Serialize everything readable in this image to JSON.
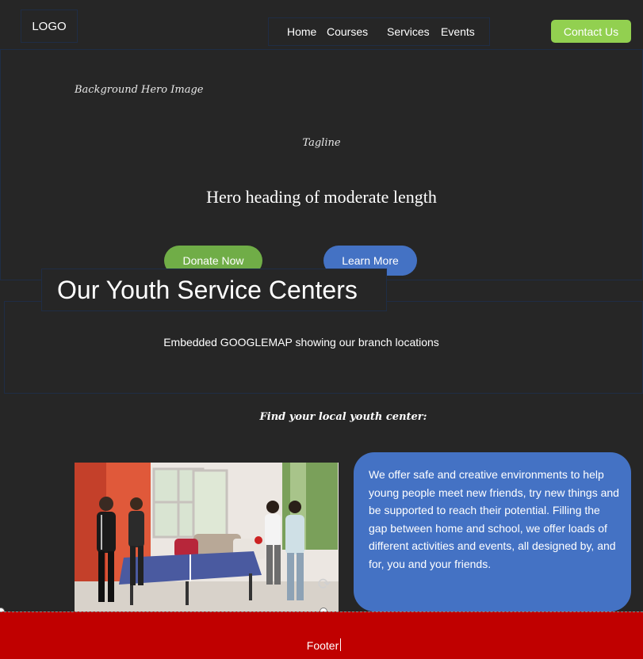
{
  "header": {
    "logo": "LOGO",
    "nav": [
      "Home",
      "Courses",
      "Services",
      "Events"
    ],
    "contact_button": "Contact Us"
  },
  "hero": {
    "background_label": "Background Hero Image",
    "tagline": "Tagline",
    "heading": "Hero heading of moderate length",
    "donate_button": "Donate Now",
    "learn_button": "Learn More"
  },
  "section": {
    "title": "Our Youth Service Centers",
    "map_label": "Embedded GOOGLEMAP showing our branch locations",
    "find_label": "Find your local youth center:"
  },
  "info": {
    "text": "We offer safe and creative environments to help young people meet new friends, try new things and be supported to reach their potential. Filling the gap between home and school, we offer loads of different activities and events, all designed by, and for, you and your friends."
  },
  "footer": {
    "label": "Footer"
  },
  "colors": {
    "background": "#262626",
    "contact_green": "#92d050",
    "donate_green": "#70ad47",
    "accent_blue": "#4472c4",
    "footer_red": "#c00000"
  },
  "icons": {
    "rotate_handle": "rotate-icon"
  }
}
